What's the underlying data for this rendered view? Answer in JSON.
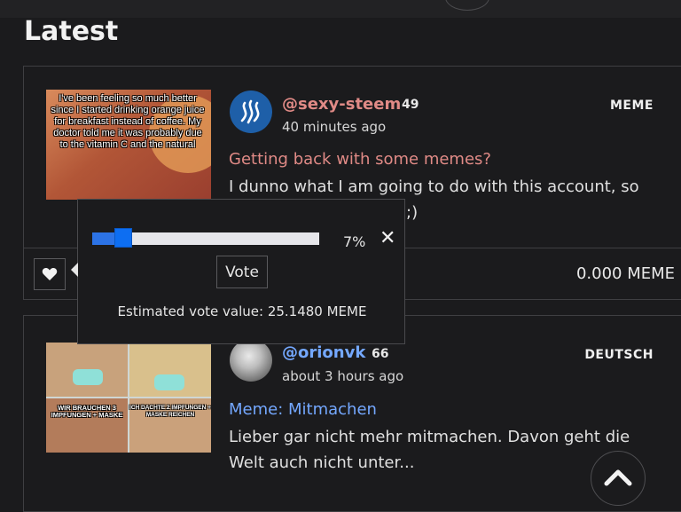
{
  "page": {
    "title": "Latest"
  },
  "posts": [
    {
      "author": "@sexy-steem",
      "reputation": "49",
      "time": "40 minutes ago",
      "tag": "MEME",
      "title": "Getting back with some memes?",
      "excerpt": "I dunno what I am going to do with this account, so",
      "excerpt_tail": ";)",
      "thumbnail_text": "I've been feeling so much better since I started drinking orange juice for breakfast instead of coffee. My doctor told me it was probably due to the vitamin C and the natural",
      "payout": "0.000 MEME",
      "like_icon": "heart-icon"
    },
    {
      "author": "@orionvk",
      "reputation": "66",
      "time": "about 3 hours ago",
      "tag": "DEUTSCH",
      "title": "Meme: Mitmachen",
      "excerpt": "Lieber gar nicht mehr mitmachen. Davon geht die Welt auch nicht unter...",
      "thumbnail_caption_left": "WIR BRAUCHEN 3 IMPFUNGEN + MASKE",
      "thumbnail_caption_right": "ICH DACHTE 2 IMPFUNGEN + MASKE REICHEN"
    }
  ],
  "vote_popup": {
    "percent_value": 0.07,
    "percent_label": "7%",
    "vote_label": "Vote",
    "estimate": "Estimated vote value: 25.1480 MEME",
    "close_icon": "close-icon"
  },
  "colors": {
    "background": "#1b1b1d",
    "meme_accent": "#e08a86",
    "deutsch_accent": "#74a8ff",
    "slider_blue": "#0d6ef2"
  }
}
